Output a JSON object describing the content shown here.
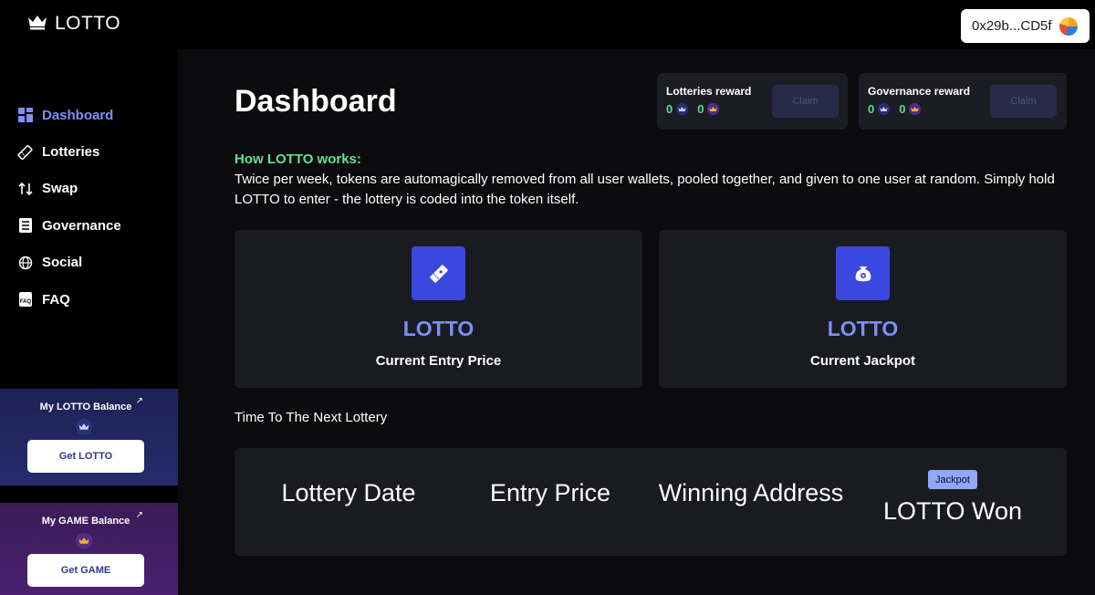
{
  "app": {
    "logo_text": "LOTTO",
    "wallet_address": "0x29b...CD5f"
  },
  "sidebar": {
    "items": [
      {
        "label": "Dashboard",
        "icon": "dashboard-icon",
        "active": true
      },
      {
        "label": "Lotteries",
        "icon": "ticket-icon",
        "active": false
      },
      {
        "label": "Swap",
        "icon": "swap-arrows-icon",
        "active": false
      },
      {
        "label": "Governance",
        "icon": "governance-icon",
        "active": false
      },
      {
        "label": "Social",
        "icon": "globe-icon",
        "active": false
      },
      {
        "label": "FAQ",
        "icon": "faq-icon",
        "active": false
      }
    ],
    "lotto_balance": {
      "title": "My LOTTO Balance",
      "button": "Get LOTTO"
    },
    "game_balance": {
      "title": "My GAME Balance",
      "button": "Get GAME"
    }
  },
  "main": {
    "title": "Dashboard",
    "rewards": [
      {
        "title": "Lotteries reward",
        "value_lotto": "0",
        "value_game": "0",
        "button": "Claim"
      },
      {
        "title": "Governance reward",
        "value_lotto": "0",
        "value_game": "0",
        "button": "Claim"
      }
    ],
    "how": {
      "title": "How LOTTO works:",
      "text": "Twice per week, tokens are automagically removed from all user wallets, pooled together, and given to one user at random. Simply hold LOTTO to enter - the lottery is coded into the token itself."
    },
    "stats": [
      {
        "value": "LOTTO",
        "label": "Current Entry Price",
        "icon": "ticket-icon"
      },
      {
        "value": "LOTTO",
        "label": "Current Jackpot",
        "icon": "money-bag-icon"
      }
    ],
    "next_lottery_label": "Time To The Next Lottery",
    "history": {
      "columns": [
        "Lottery Date",
        "Entry Price",
        "Winning Address",
        "LOTTO Won"
      ],
      "jackpot_badge": "Jackpot"
    }
  },
  "colors": {
    "accent": "#7b8ff5",
    "green": "#63e28c",
    "icon_bg": "#3b48e0",
    "card_bg": "#1a1b21"
  }
}
